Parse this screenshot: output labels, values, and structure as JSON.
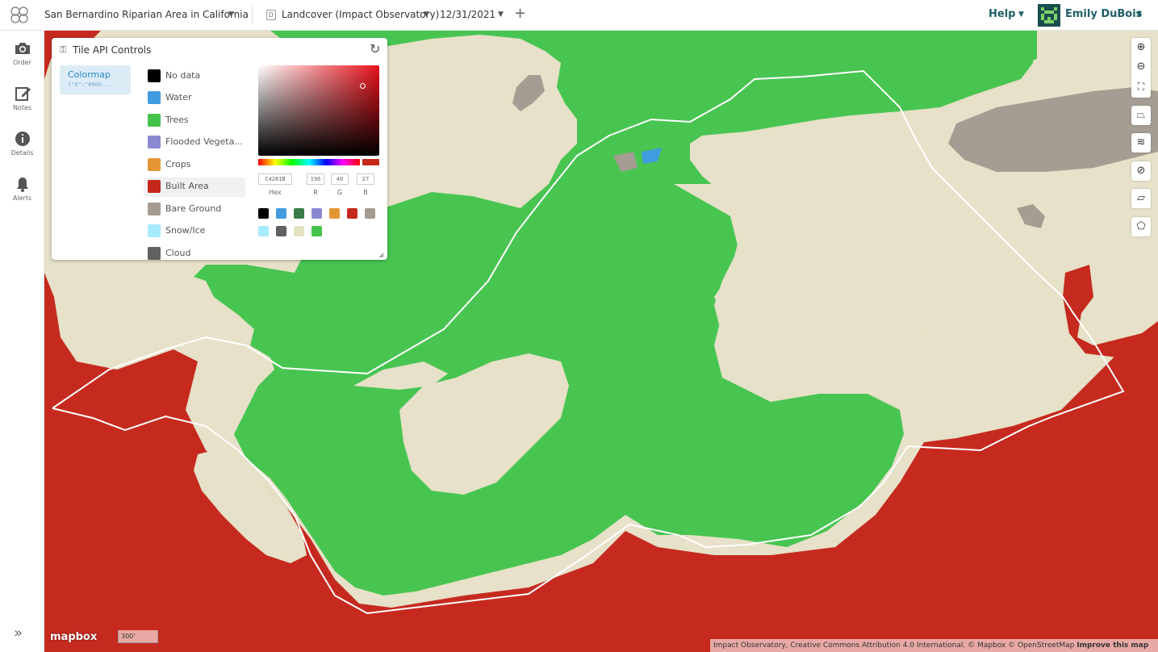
{
  "topbar": {
    "aoi_name": "San Bernardino Riparian Area in California",
    "layer_name": "Landcover (Impact Observatory)",
    "date": "12/31/2021",
    "add_symbol": "+",
    "help_label": "Help",
    "user_name": "Emily DuBois"
  },
  "sidebar": {
    "items": [
      {
        "label": "Order",
        "icon": "camera-icon"
      },
      {
        "label": "Notes",
        "icon": "edit-icon"
      },
      {
        "label": "Details",
        "icon": "info-icon"
      },
      {
        "label": "Alerts",
        "icon": "bell-icon"
      }
    ],
    "expand_symbol": "»"
  },
  "panel": {
    "title": "Tile API Controls",
    "tab_label": "Colormap",
    "tab_sub": "{\"0\":\"#000...",
    "legend": [
      {
        "label": "No data",
        "color": "#000000"
      },
      {
        "label": "Water",
        "color": "#419bdf"
      },
      {
        "label": "Trees",
        "color": "#45c24b"
      },
      {
        "label": "Flooded Vegeta...",
        "color": "#8a88d0"
      },
      {
        "label": "Crops",
        "color": "#e49635"
      },
      {
        "label": "Built Area",
        "color": "#c4281b"
      },
      {
        "label": "Bare Ground",
        "color": "#a59b8f"
      },
      {
        "label": "Snow/Ice",
        "color": "#a8ebff"
      },
      {
        "label": "Cloud",
        "color": "#616161"
      }
    ],
    "picker": {
      "hex_value": "C4281B",
      "r_value": "196",
      "g_value": "40",
      "b_value": "27",
      "hex_label": "Hex",
      "r_label": "R",
      "g_label": "G",
      "b_label": "B",
      "current_color": "#c4281b",
      "presets": [
        "#000000",
        "#419bdf",
        "#397d49",
        "#8a88d0",
        "#e49635",
        "#c4281b",
        "#a59b8f",
        "#a8ebff",
        "#616161",
        "#e3e2c3",
        "#45c24b"
      ]
    }
  },
  "map": {
    "colors": {
      "background": "#e6e1c8",
      "trees": "#48c551",
      "built": "#c62a1f",
      "bare": "#a59d93",
      "water": "#419bdf",
      "boundary": "#ffffff"
    },
    "scale_label": "300'",
    "logo_label": "mapbox",
    "attribution": "Impact Observatory, Creative Commons Attribution 4.0 International. © Mapbox © OpenStreetMap",
    "attribution_link": "Improve this map"
  }
}
